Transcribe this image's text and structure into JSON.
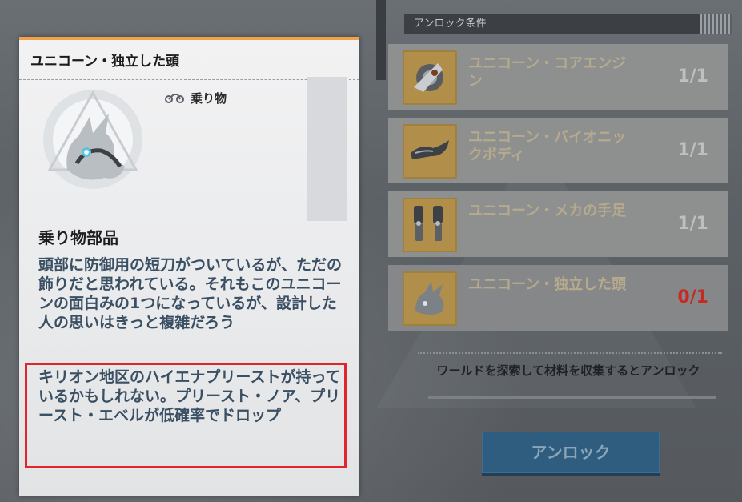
{
  "unlock_panel": {
    "header": "アンロック条件",
    "requirements": [
      {
        "name": "ユニコーン・コアエンジン",
        "count": "1/1",
        "icon": "engine-part-icon",
        "status": "owned"
      },
      {
        "name": "ユニコーン・バイオニックボディ",
        "count": "1/1",
        "icon": "body-part-icon",
        "status": "owned"
      },
      {
        "name": "ユニコーン・メカの手足",
        "count": "1/1",
        "icon": "limbs-part-icon",
        "status": "owned"
      },
      {
        "name": "ユニコーン・独立した頭",
        "count": "0/1",
        "icon": "head-part-icon",
        "status": "missing"
      }
    ],
    "hint": "ワールドを探索して材料を収集するとアンロック",
    "unlock_button": "アンロック",
    "missing_count_color": "#c42b25"
  },
  "tooltip": {
    "title": "ユニコーン・独立した頭",
    "category": "乗り物",
    "category_icon": "motorcycle-icon",
    "item_icon": "unicorn-head-icon",
    "accent_color": "#f0a24a",
    "section_heading": "乗り物部品",
    "description": "頭部に防御用の短刀がついているが、ただの飾りだと思われている。それもこのユニコーンの面白みの1つになっているが、設計した人の思いはきっと複雑だろう",
    "drop_info": "キリオン地区のハイエナプリーストが持っているかもしれない。プリースト・ノア、プリースト・エベルが低確率でドロップ",
    "highlight_color": "#e0262c"
  }
}
